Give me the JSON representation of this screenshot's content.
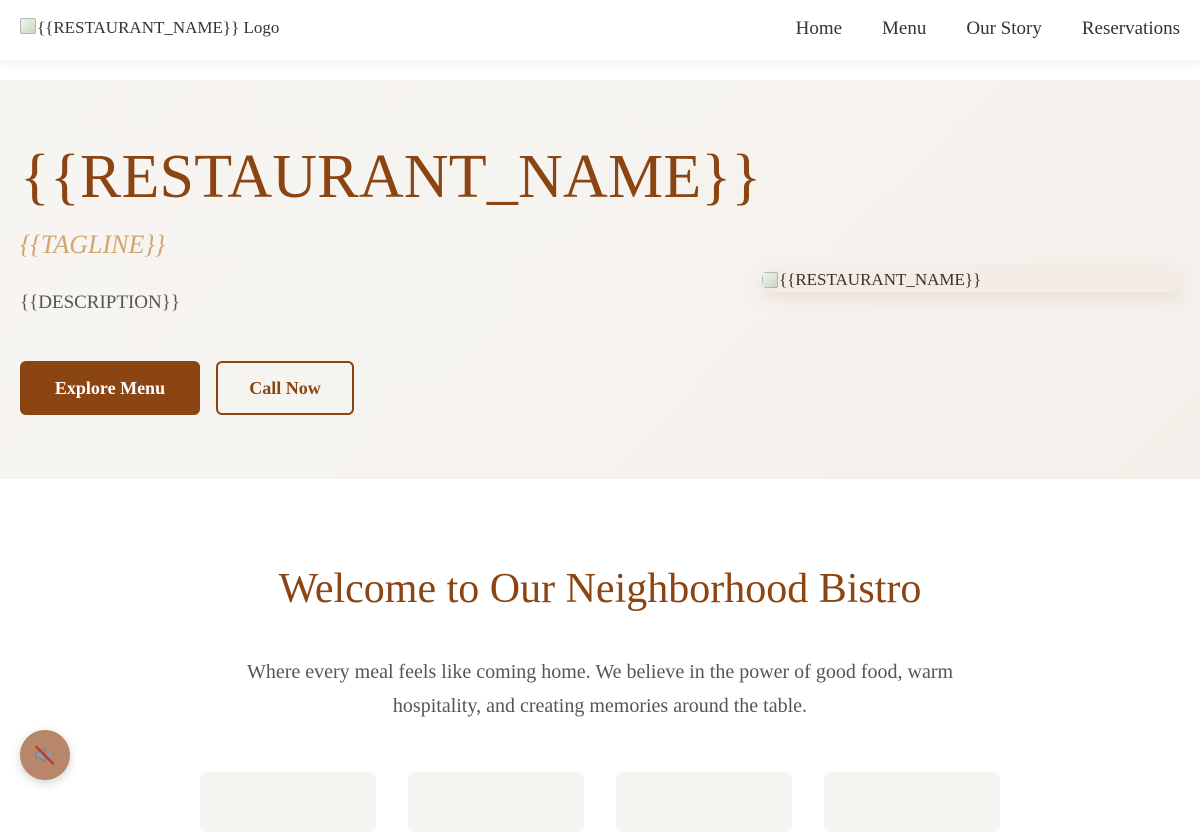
{
  "header": {
    "logo_alt": "{{RESTAURANT_NAME}} Logo",
    "nav": [
      {
        "label": "Home"
      },
      {
        "label": "Menu"
      },
      {
        "label": "Our Story"
      },
      {
        "label": "Reservations"
      }
    ]
  },
  "hero": {
    "title": "{{RESTAURANT_NAME}}",
    "tagline": "{{TAGLINE}}",
    "description": "{{DESCRIPTION}}",
    "primary_button": "Explore Menu",
    "secondary_button": "Call Now",
    "image_alt": "{{RESTAURANT_NAME}}"
  },
  "welcome": {
    "title": "Welcome to Our Neighborhood Bistro",
    "text": "Where every meal feels like coming home. We believe in the power of good food, warm hospitality, and creating memories around the table."
  },
  "audio_button": {
    "icon": "muted-speaker-icon"
  },
  "colors": {
    "brand": "#8b4513",
    "tagline": "#d2a56e",
    "hero_bg": "#f7f5f2",
    "audio_button_bg": "#b8876a"
  }
}
